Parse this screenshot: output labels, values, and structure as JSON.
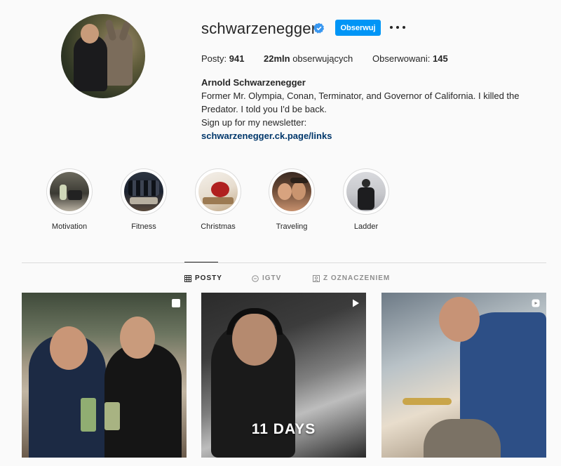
{
  "profile": {
    "username": "schwarzenegger",
    "follow_label": "Obserwuj",
    "posts_label": "Posty:",
    "posts_count": "941",
    "followers_count": "22mln",
    "followers_label": "obserwujących",
    "following_label": "Obserwowani:",
    "following_count": "145",
    "full_name": "Arnold Schwarzenegger",
    "bio_line1": "Former Mr. Olympia, Conan, Terminator, and Governor of California. I killed the",
    "bio_line2": "Predator. I told you I'd be back.",
    "bio_line3": "Sign up for my newsletter:",
    "bio_link": "schwarzenegger.ck.page/links"
  },
  "highlights": [
    {
      "label": "Motivation"
    },
    {
      "label": "Fitness"
    },
    {
      "label": "Christmas"
    },
    {
      "label": "Traveling"
    },
    {
      "label": "Ladder"
    }
  ],
  "tabs": [
    {
      "label": "POSTY",
      "icon": "grid-icon",
      "active": true
    },
    {
      "label": "IGTV",
      "icon": "igtv-icon",
      "active": false
    },
    {
      "label": "Z OZNACZENIEM",
      "icon": "tagged-icon",
      "active": false
    }
  ],
  "posts": [
    {
      "type_icon": "carousel-icon"
    },
    {
      "type_icon": "video-icon",
      "overlay_text": "11 DAYS"
    },
    {
      "type_icon": "reel-icon"
    }
  ],
  "colors": {
    "accent": "#0095f6",
    "link": "#00376b",
    "verified": "#3897f0",
    "text": "#262626",
    "muted": "#8e8e8e"
  }
}
